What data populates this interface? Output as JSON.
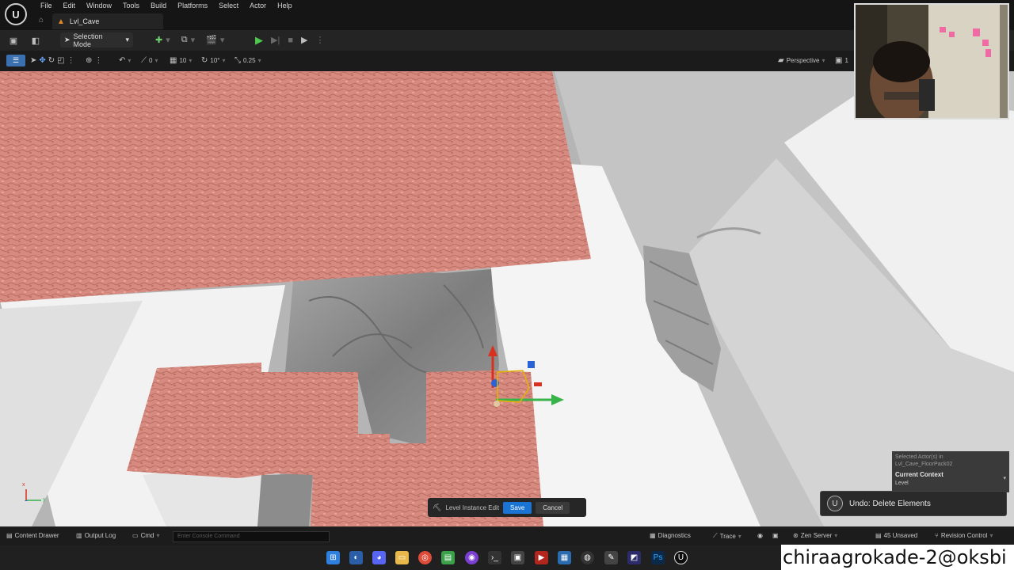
{
  "menu": {
    "items": [
      "File",
      "Edit",
      "Window",
      "Tools",
      "Build",
      "Platforms",
      "Select",
      "Actor",
      "Help"
    ],
    "level_tab": "Lvl_Cave"
  },
  "toolbar": {
    "selection_mode": "Selection Mode"
  },
  "viewport_toolbar": {
    "rotation_snap_count": "0",
    "grid_snap": "10",
    "angle_snap": "10°",
    "scale_snap": "0.25",
    "view_mode": "Perspective",
    "extra": "1"
  },
  "overlay_panel": {
    "line1": "Selected Actor(s) in",
    "line2": "Lvl_Cave_FloorPack02",
    "context_title": "Current Context",
    "context_value": "Level"
  },
  "undo_toast": {
    "message": "Undo: Delete Elements"
  },
  "level_instance_bar": {
    "label": "Level Instance Edit",
    "save": "Save",
    "cancel": "Cancel"
  },
  "statusbar": {
    "content_drawer": "Content Drawer",
    "output_log": "Output Log",
    "cmd": "Cmd",
    "console_placeholder": "Enter Console Command",
    "diagnostics": "Diagnostics",
    "trace": "Trace",
    "zen_server": "Zen Server",
    "unsaved": "45 Unsaved",
    "revision_control": "Revision Control"
  },
  "axis_labels": {
    "x": "x",
    "y": "y"
  },
  "watermark": "chiraagrokade-2@oksbi",
  "colors": {
    "tile_red": "#d98a7e",
    "gizmo_z": "#d8311f",
    "gizmo_y": "#37b34a",
    "gizmo_x": "#2a63d6",
    "save_blue": "#1a74d3"
  }
}
